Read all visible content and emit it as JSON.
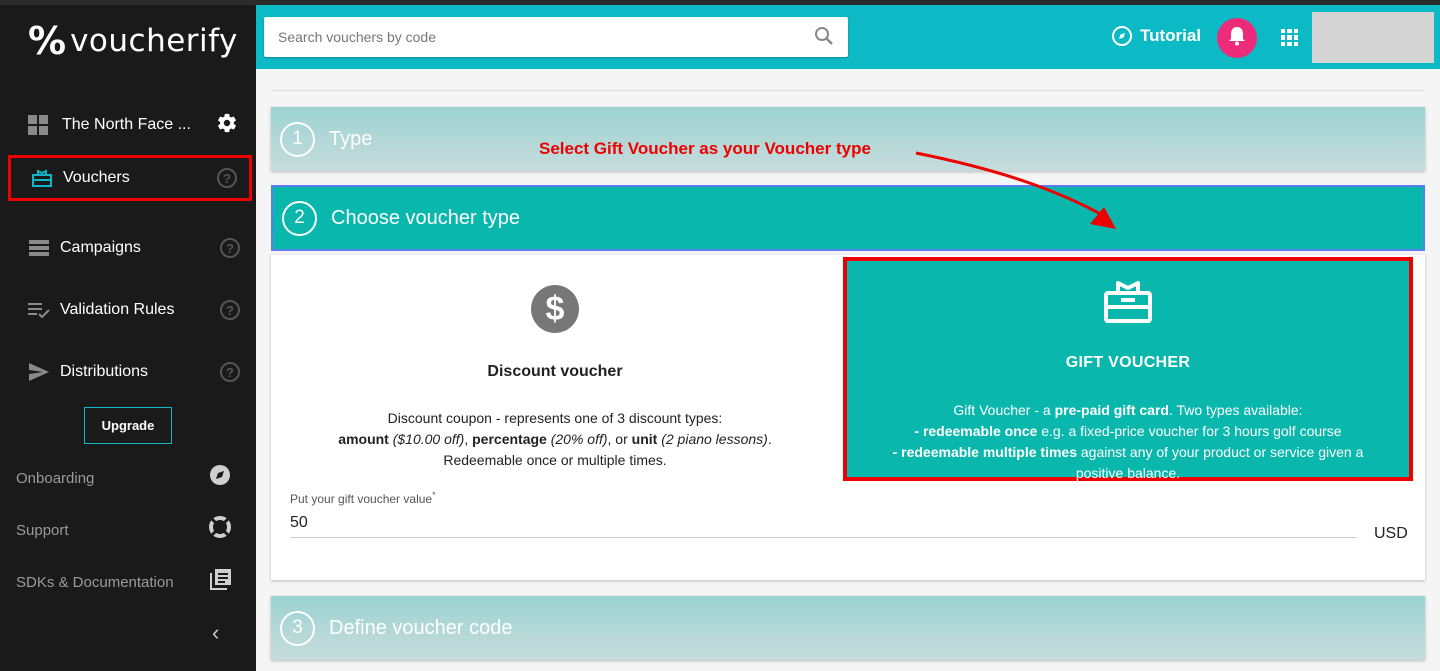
{
  "brand": {
    "mark": "%",
    "name": "voucherify"
  },
  "project": {
    "name": "The North Face ..."
  },
  "nav": {
    "items": [
      {
        "label": "Vouchers",
        "help": "?"
      },
      {
        "label": "Campaigns",
        "help": "?"
      },
      {
        "label": "Validation Rules",
        "help": "?"
      },
      {
        "label": "Distributions",
        "help": "?"
      }
    ],
    "upgrade_label": "Upgrade",
    "bottom": [
      {
        "label": "Onboarding"
      },
      {
        "label": "Support"
      },
      {
        "label": "SDKs & Documentation"
      }
    ],
    "collapse_glyph": "‹"
  },
  "topbar": {
    "search_placeholder": "Search vouchers by code",
    "tutorial_label": "Tutorial"
  },
  "steps": [
    {
      "number": "1",
      "title": "Type"
    },
    {
      "number": "2",
      "title": "Choose voucher type"
    },
    {
      "number": "3",
      "title": "Define voucher code"
    }
  ],
  "annotation": {
    "text": "Select Gift Voucher as your Voucher type",
    "color": "#ee0000"
  },
  "discount": {
    "title": "Discount voucher",
    "desc_line1": "Discount coupon - represents one of 3 discount types:",
    "amount_label": "amount",
    "amount_example": "($10.00 off)",
    "percentage_label": "percentage",
    "percentage_example": "(20% off)",
    "or_text": ", or",
    "unit_label": "unit",
    "unit_example": "(2 piano lessons)",
    "desc_line3": "Redeemable once or multiple times."
  },
  "gift": {
    "title": "GIFT VOUCHER",
    "desc_intro": "Gift Voucher - a",
    "desc_bold": "pre-paid gift card",
    "desc_tail": ". Two types available:",
    "once_bold": "- redeemable once",
    "once_tail": "e.g. a fixed-price voucher for 3 hours golf course",
    "multi_bold": "- redeemable multiple times",
    "multi_tail": "against any of your product or service given a positive balance."
  },
  "value_field": {
    "label": "Put your gift voucher value",
    "required_mark": "*",
    "value": "50",
    "currency": "USD"
  },
  "colors": {
    "accent": "#0bbac4",
    "selected_card": "#0ab7ad",
    "highlight": "#ee0000",
    "bell": "#ee2a7b"
  }
}
